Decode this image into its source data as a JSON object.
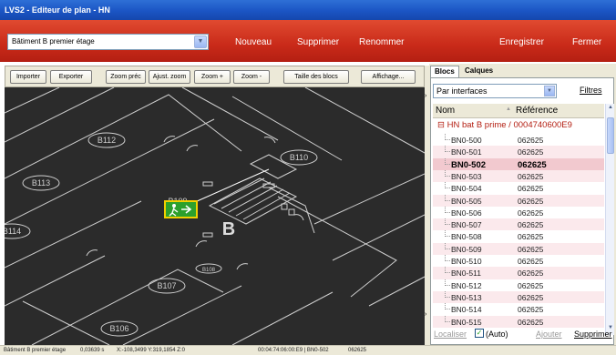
{
  "window": {
    "title": "LVS2 - Editeur de plan - HN"
  },
  "topbar": {
    "plan_value": "Bâtiment B premier étage",
    "nouveau": "Nouveau",
    "supprimer": "Supprimer",
    "renommer": "Renommer",
    "enregistrer": "Enregistrer",
    "fermer": "Fermer"
  },
  "toolbar": {
    "importer": "Importer",
    "exporter": "Exporter",
    "zoom_prec": "Zoom préc",
    "ajust_zoom": "Ajust. zoom",
    "zoom_plus": "Zoom +",
    "zoom_minus": "Zoom -",
    "taille_blocs": "Taille des blocs",
    "affichage": "Affichage..."
  },
  "canvas": {
    "rooms": [
      "B112",
      "B110",
      "B113",
      "B109",
      "B114",
      "B107",
      "B108",
      "B106"
    ],
    "stair_label": "B",
    "exit_sign": "exit-sign-icon"
  },
  "panel": {
    "tabs": [
      "Blocs",
      "Calques"
    ],
    "filter_value": "Par interfaces",
    "filtres": "Filtres",
    "columns": [
      "Nom",
      "Référence"
    ],
    "group": "HN bat B prime / 0004740600E9",
    "rows": [
      {
        "name": "BN0-500",
        "ref": "062625"
      },
      {
        "name": "BN0-501",
        "ref": "062625"
      },
      {
        "name": "BN0-502",
        "ref": "062625"
      },
      {
        "name": "BN0-503",
        "ref": "062625"
      },
      {
        "name": "BN0-504",
        "ref": "062625"
      },
      {
        "name": "BN0-505",
        "ref": "062625"
      },
      {
        "name": "BN0-506",
        "ref": "062625"
      },
      {
        "name": "BN0-507",
        "ref": "062625"
      },
      {
        "name": "BN0-508",
        "ref": "062625"
      },
      {
        "name": "BN0-509",
        "ref": "062625"
      },
      {
        "name": "BN0-510",
        "ref": "062625"
      },
      {
        "name": "BN0-511",
        "ref": "062625"
      },
      {
        "name": "BN0-512",
        "ref": "062625"
      },
      {
        "name": "BN0-513",
        "ref": "062625"
      },
      {
        "name": "BN0-514",
        "ref": "062625"
      },
      {
        "name": "BN0-515",
        "ref": "062625"
      }
    ],
    "selected_index": 2,
    "localiser": "Localiser",
    "auto": "(Auto)",
    "ajouter": "Ajouter",
    "supprimer": "Supprimer"
  },
  "status": {
    "plan": "Bâtiment B premier étage",
    "time": "0,03639 s",
    "coords": "X:-108,3499  Y:319,1854  Z:0",
    "id": "00:04:74:06:00:E9 | BN0-502",
    "ref": "062625"
  },
  "colors": {
    "title_blue": "#1b55c4",
    "toolbar_red": "#c92a19",
    "canvas_bg": "#2b2b2b",
    "selected_row": "#f2c9cf",
    "exit_green": "#2ca02c",
    "exit_border": "#f0d000"
  }
}
